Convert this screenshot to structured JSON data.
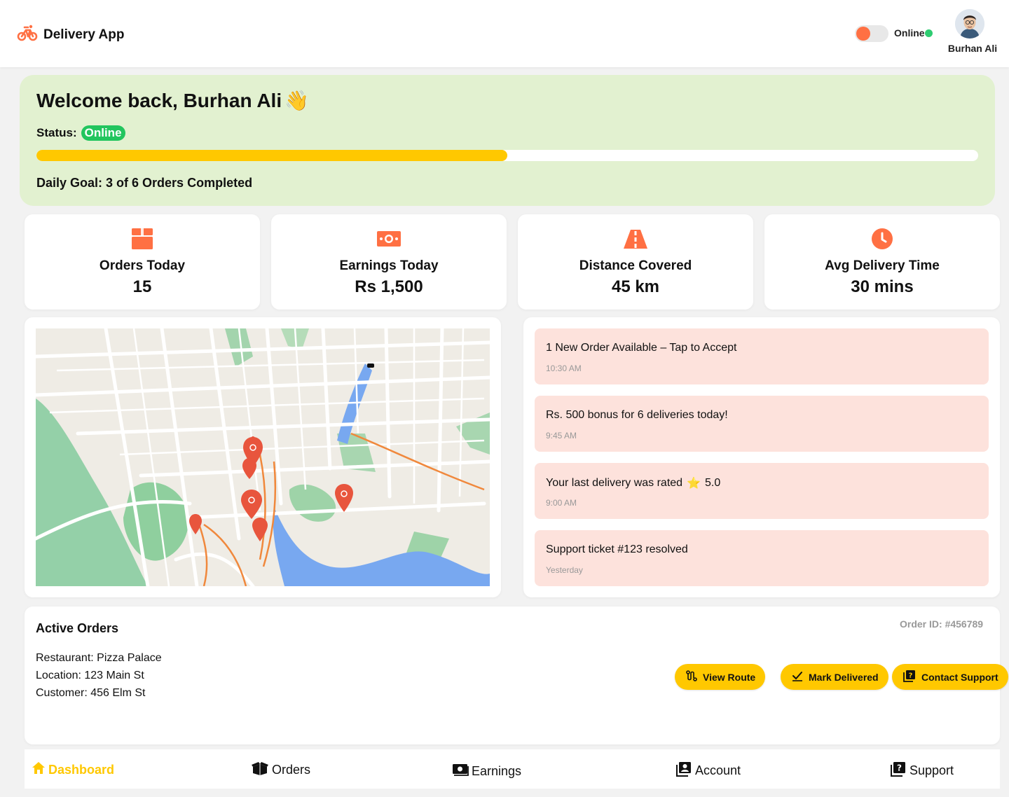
{
  "app": {
    "title": "Delivery App",
    "logo_icon": "bike-icon"
  },
  "header": {
    "online_label": "Online",
    "user_name": "Burhan Ali"
  },
  "welcome": {
    "title": "Welcome back, Burhan Ali",
    "emoji": "👋",
    "status_label": "Status:",
    "status_value": "Online",
    "goal_text": "Daily Goal: 3 of 6 Orders Completed",
    "goal_completed": 3,
    "goal_total": 6
  },
  "stats": [
    {
      "icon": "box-icon",
      "label": "Orders Today",
      "value": "15"
    },
    {
      "icon": "money-icon",
      "label": "Earnings Today",
      "value": "Rs 1,500"
    },
    {
      "icon": "road-icon",
      "label": "Distance Covered",
      "value": "45 km"
    },
    {
      "icon": "clock-icon",
      "label": "Avg Delivery Time",
      "value": "30 mins"
    }
  ],
  "notifications": [
    {
      "title": "1 New Order Available – Tap to Accept",
      "time": "10:30 AM"
    },
    {
      "title": "Rs. 500 bonus for 6 deliveries today!",
      "time": "9:45 AM"
    },
    {
      "title": "Your last delivery was rated",
      "star": "⭐",
      "rating": "5.0",
      "time": "9:00 AM"
    },
    {
      "title": "Support ticket #123 resolved",
      "time": "Yesterday"
    }
  ],
  "active_orders": {
    "title": "Active Orders",
    "order_id": "Order ID: #456789",
    "restaurant": "Restaurant: Pizza Palace",
    "location": "Location: 123 Main St",
    "customer": "Customer: 456 Elm St",
    "buttons": {
      "view_route": "View Route",
      "mark_delivered": "Mark Delivered",
      "contact_support": "Contact Support"
    }
  },
  "bottom_nav": [
    {
      "label": "Dashboard",
      "icon": "home-icon",
      "active": true
    },
    {
      "label": "Orders",
      "icon": "box-open-icon"
    },
    {
      "label": "Earnings",
      "icon": "money-bill-icon"
    },
    {
      "label": "Account",
      "icon": "account-icon"
    },
    {
      "label": "Support",
      "icon": "question-icon"
    }
  ],
  "colors": {
    "accent_orange": "#ff7043",
    "accent_yellow": "#ffc800",
    "online_green": "#22c55e",
    "banner_bg": "#e2f1d0",
    "notification_bg": "#fde2dc"
  }
}
